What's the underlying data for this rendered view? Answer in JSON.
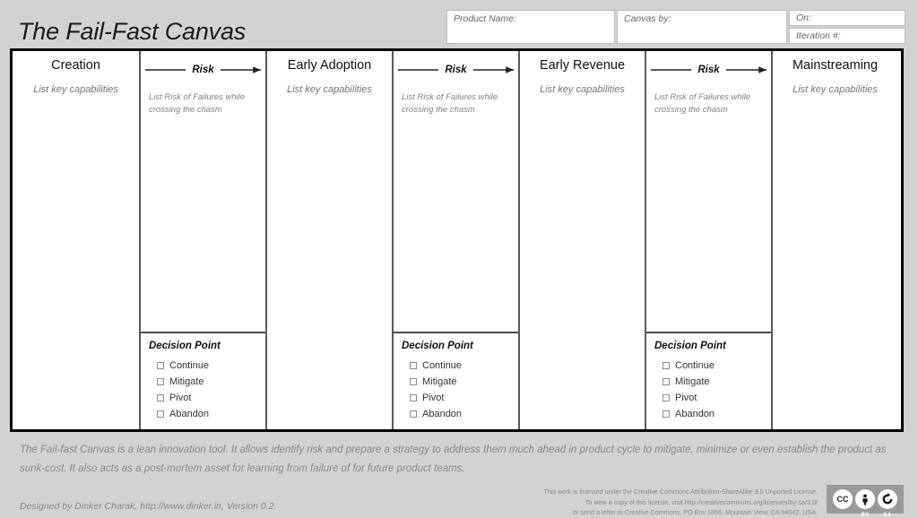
{
  "header": {
    "title": "The Fail-Fast Canvas",
    "meta": {
      "product_name_label": "Product Name:",
      "canvas_by_label": "Canvas by:",
      "on_label": "On:",
      "iteration_label": "Iteration #:",
      "product_name_value": "",
      "canvas_by_value": "",
      "on_value": "",
      "iteration_value": ""
    }
  },
  "canvas": {
    "stage_hint": "List key capabilities",
    "risk_label": "Risk",
    "risk_hint": "List Risk of Failures while crossing the chasm",
    "decision_title": "Decision Point",
    "decision_options": [
      "Continue",
      "Mitigate",
      "Pivot",
      "Abandon"
    ],
    "stages": [
      {
        "name": "Creation"
      },
      {
        "name": "Early Adoption"
      },
      {
        "name": "Early Revenue"
      },
      {
        "name": "Mainstreaming"
      }
    ],
    "columns": [
      {
        "type": "stage",
        "index": 0
      },
      {
        "type": "risk",
        "index": 0
      },
      {
        "type": "stage",
        "index": 1
      },
      {
        "type": "risk",
        "index": 1
      },
      {
        "type": "stage",
        "index": 2
      },
      {
        "type": "risk",
        "index": 2
      },
      {
        "type": "stage",
        "index": 3
      }
    ]
  },
  "footer": {
    "description": "The Fail-fast Canvas is a lean innovation tool. It allows identify risk and prepare a strategy to address them much ahead in product cycle to mitigate, minimize or even establish the product as sunk-cost. It also acts as a post-mortem asset for learning from failure of for future product teams.",
    "credit": "Designed by Dinker Charak, http://www.dinker.in, Version 0.2.",
    "license_line1": "This work is licensed under the Creative Commons Attribution-ShareAlike 3.0 Unported License.",
    "license_line2": "To view a copy of this license, visit http://creativecommons.org/licenses/by-sa/3.0/",
    "license_line3": "or send a letter to Creative Commons, PO Box 1866, Mountain View, CA 94042, USA.",
    "cc_mark": "CC",
    "cc_by": "BY",
    "cc_sa": "SA"
  },
  "colors": {
    "page_background": "#d2d2d2",
    "canvas_background": "#ffffff",
    "frame_border": "#000000",
    "divider": "#5a5a5a",
    "hint_text": "#757575",
    "footer_text": "#8a8a8a"
  }
}
